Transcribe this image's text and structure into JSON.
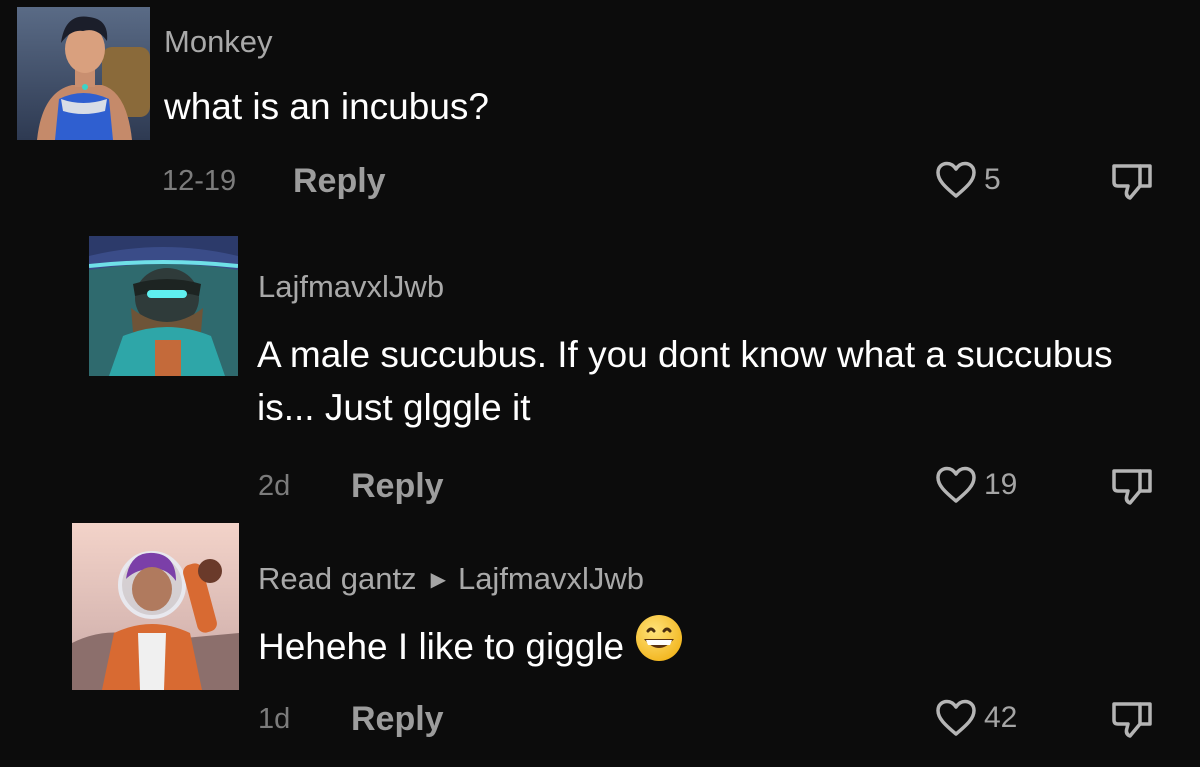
{
  "comments": [
    {
      "username": "Monkey",
      "text": "what is an incubus?",
      "time": "12-19",
      "reply_label": "Reply",
      "likes": "5"
    },
    {
      "username": "LajfmavxlJwb",
      "text": "A male succubus. If you dont know what a succubus is... Just glggle it",
      "time": "2d",
      "reply_label": "Reply",
      "likes": "19"
    },
    {
      "username": "Read gantz",
      "reply_to": "LajfmavxlJwb",
      "text": "Hehehe I like to giggle",
      "time": "1d",
      "reply_label": "Reply",
      "likes": "42"
    }
  ],
  "icons": {
    "like": "heart-outline-icon",
    "dislike": "thumbs-down-outline-icon",
    "reply_arrow": "triangle-right-icon",
    "emoji": "grinning-face-emoji"
  },
  "colors": {
    "background": "#0c0c0c",
    "username": "#a9a9a9",
    "text": "#ffffff",
    "meta": "#7c7c7c"
  }
}
